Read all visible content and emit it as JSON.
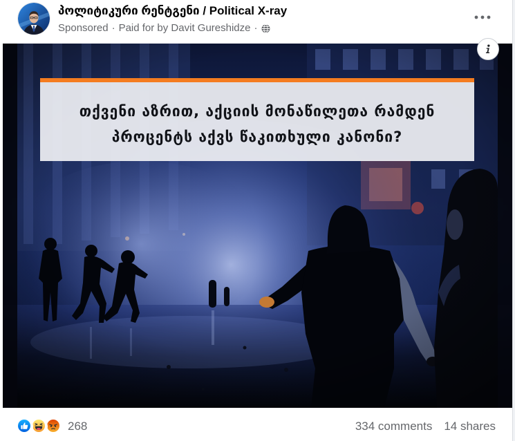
{
  "colors": {
    "primary_text": "#050505",
    "secondary_text": "#65676b",
    "ad_accent": "#f47c20",
    "like_blue": "#1877f2"
  },
  "post": {
    "page_name": "პოლიტიკური რენტგენი / Political X-ray",
    "sponsored_label": "Sponsored",
    "separator": "·",
    "paid_for": "Paid for by Davit Gureshidze",
    "audience_icon": "globe-icon",
    "more_icon": "more-options-icon"
  },
  "ad_image": {
    "info_icon": "info-icon",
    "headline": [
      "თქვენი აზრით, აქციის მონაწილეთა რამდენ",
      "პროცენტს აქვს წაკითხული კანონი?"
    ]
  },
  "engagement": {
    "reaction_icons": [
      "like-icon",
      "haha-icon",
      "angry-icon"
    ],
    "reaction_count": "268",
    "comments_label": "334 comments",
    "shares_label": "14 shares"
  }
}
